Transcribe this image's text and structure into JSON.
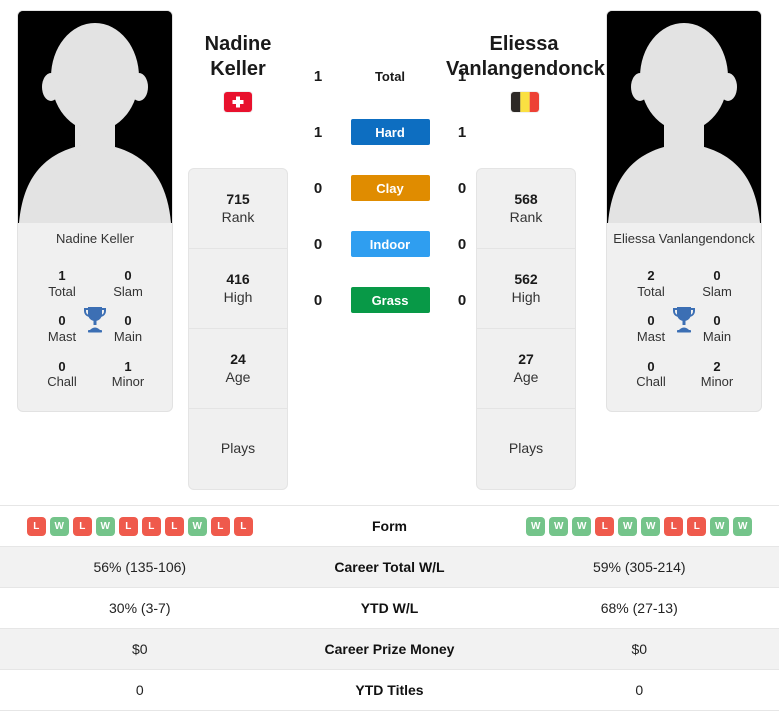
{
  "players": {
    "left": {
      "first_name": "Nadine",
      "last_name": "Keller",
      "full_name": "Nadine Keller",
      "country": "Switzerland",
      "flag": "swiss-flag",
      "titles": [
        {
          "value": "1",
          "label": "Total"
        },
        {
          "value": "0",
          "label": "Slam"
        },
        {
          "value": "0",
          "label": "Mast"
        },
        {
          "value": "0",
          "label": "Main"
        },
        {
          "value": "0",
          "label": "Chall"
        },
        {
          "value": "1",
          "label": "Minor"
        }
      ],
      "profile": [
        {
          "value": "715",
          "label": "Rank"
        },
        {
          "value": "416",
          "label": "High"
        },
        {
          "value": "24",
          "label": "Age"
        },
        {
          "value": "",
          "label": "Plays"
        }
      ]
    },
    "right": {
      "first_name": "Eliessa",
      "last_name": "Vanlangendonck",
      "full_name": "Eliessa Vanlangendonck",
      "country": "Belgium",
      "flag": "belgian-flag",
      "titles": [
        {
          "value": "2",
          "label": "Total"
        },
        {
          "value": "0",
          "label": "Slam"
        },
        {
          "value": "0",
          "label": "Mast"
        },
        {
          "value": "0",
          "label": "Main"
        },
        {
          "value": "0",
          "label": "Chall"
        },
        {
          "value": "2",
          "label": "Minor"
        }
      ],
      "profile": [
        {
          "value": "568",
          "label": "Rank"
        },
        {
          "value": "562",
          "label": "High"
        },
        {
          "value": "27",
          "label": "Age"
        },
        {
          "value": "",
          "label": "Plays"
        }
      ]
    }
  },
  "head_to_head": [
    {
      "label": "Total",
      "left": "1",
      "right": "1",
      "color": ""
    },
    {
      "label": "Hard",
      "left": "1",
      "right": "1",
      "color": "#0d6ec1"
    },
    {
      "label": "Clay",
      "left": "0",
      "right": "0",
      "color": "#e08c00"
    },
    {
      "label": "Indoor",
      "left": "0",
      "right": "0",
      "color": "#2f9ef0"
    },
    {
      "label": "Grass",
      "left": "0",
      "right": "0",
      "color": "#089947"
    }
  ],
  "stats_table": [
    {
      "label": "Form",
      "type": "form",
      "left_form": [
        "L",
        "W",
        "L",
        "W",
        "L",
        "L",
        "L",
        "W",
        "L",
        "L"
      ],
      "right_form": [
        "W",
        "W",
        "W",
        "L",
        "W",
        "W",
        "L",
        "L",
        "W",
        "W"
      ],
      "left": "",
      "right": ""
    },
    {
      "label": "Career Total W/L",
      "type": "text",
      "left": "56% (135-106)",
      "right": "59% (305-214)"
    },
    {
      "label": "YTD W/L",
      "type": "text",
      "left": "30% (3-7)",
      "right": "68% (27-13)"
    },
    {
      "label": "Career Prize Money",
      "type": "text",
      "left": "$0",
      "right": "$0"
    },
    {
      "label": "YTD Titles",
      "type": "text",
      "left": "0",
      "right": "0"
    }
  ],
  "colors": {
    "win_badge": "#74c48a",
    "loss_badge": "#ef5a4c",
    "trophy": "#3c6fb4",
    "card_bg": "#f0f0f0",
    "alt_row": "#f2f2f2"
  }
}
